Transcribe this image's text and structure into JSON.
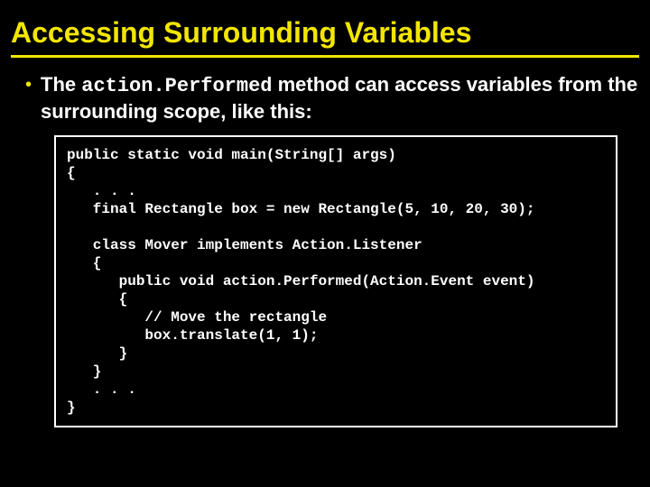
{
  "title": "Accessing Surrounding Variables",
  "bullet": {
    "prefix": "The ",
    "code": "action.Performed",
    "suffix": " method can access variables from the surrounding scope, like this:"
  },
  "code": "public static void main(String[] args)\n{\n   . . .\n   final Rectangle box = new Rectangle(5, 10, 20, 30);\n\n   class Mover implements Action.Listener\n   {\n      public void action.Performed(Action.Event event)\n      {\n         // Move the rectangle\n         box.translate(1, 1);\n      }\n   }\n   . . .\n}"
}
